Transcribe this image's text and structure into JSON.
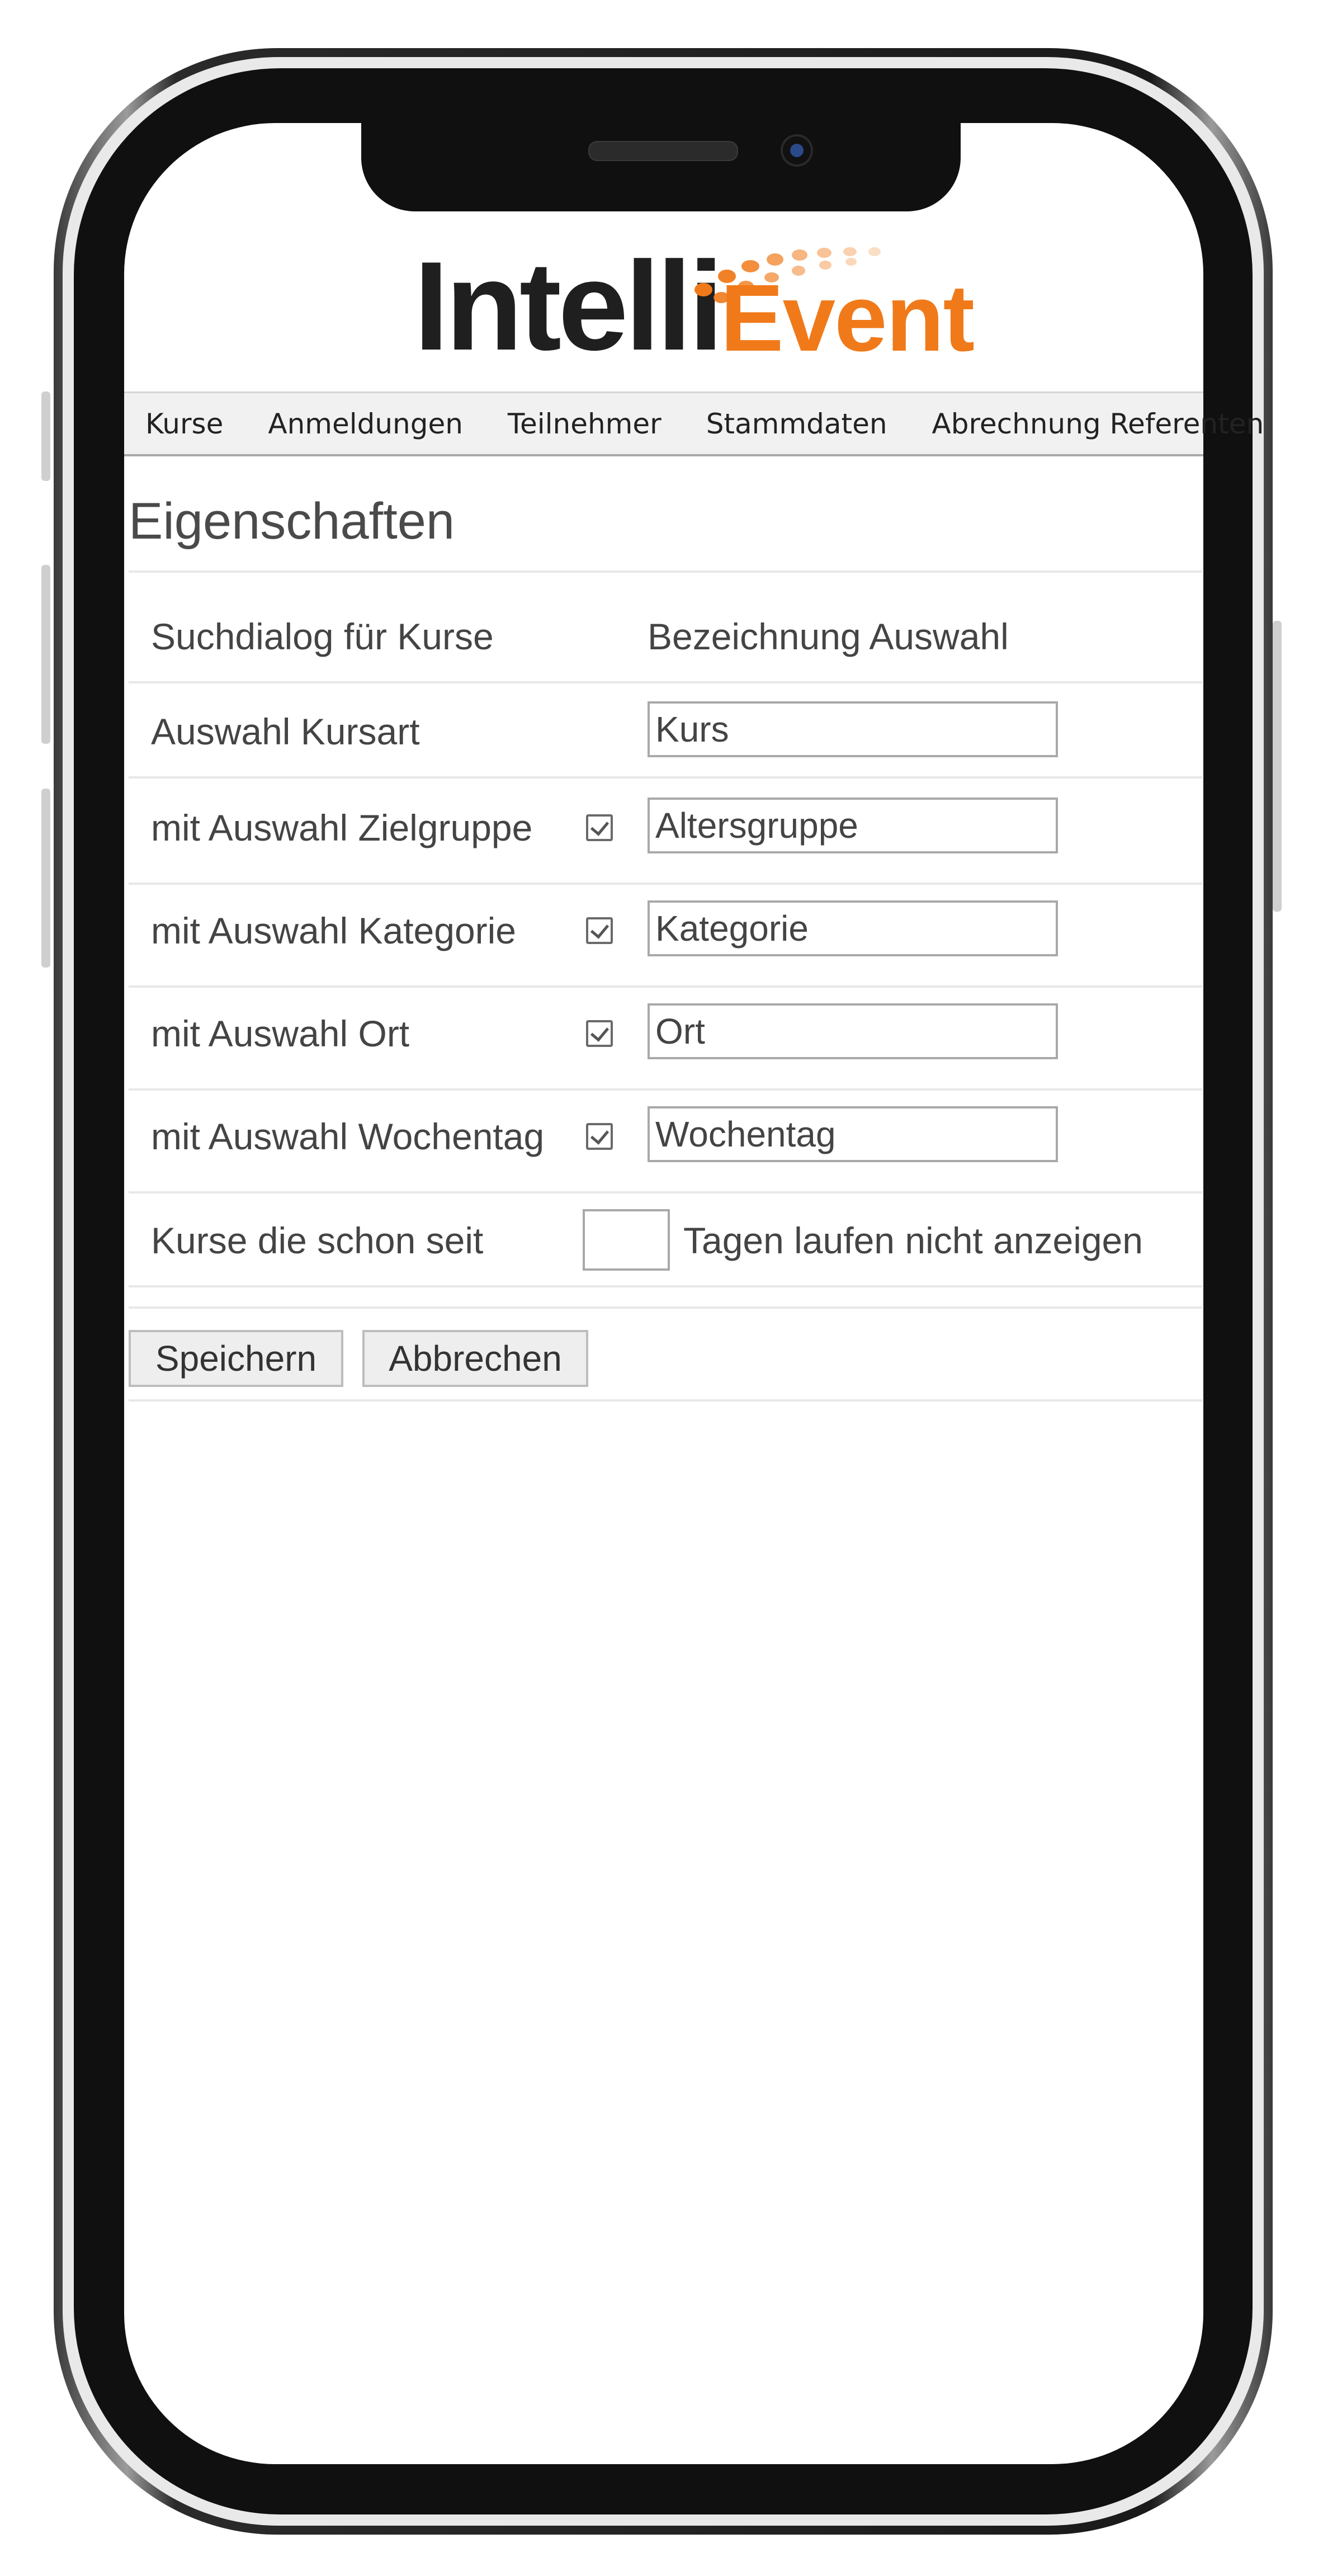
{
  "logo": {
    "part1": "Intelli",
    "part2": "Event",
    "accent": "#f07a1a",
    "dark": "#1f1f1f"
  },
  "nav": {
    "items": [
      "Kurse",
      "Anmeldungen",
      "Teilnehmer",
      "Stammdaten",
      "Abrechnung Referenten"
    ]
  },
  "page": {
    "title": "Eigenschaften"
  },
  "form": {
    "header": {
      "label": "Suchdialog für Kurse",
      "column": "Bezeichnung Auswahl"
    },
    "rows": [
      {
        "label": "Auswahl Kursart",
        "value": "Kurs",
        "checked": null
      },
      {
        "label": "mit Auswahl Zielgruppe",
        "value": "Altersgruppe",
        "checked": true
      },
      {
        "label": "mit Auswahl Kategorie",
        "value": "Kategorie",
        "checked": true
      },
      {
        "label": "mit Auswahl Ort",
        "value": "Ort",
        "checked": true
      },
      {
        "label": "mit Auswahl Wochentag",
        "value": "Wochentag",
        "checked": true
      }
    ],
    "days": {
      "label_before": "Kurse die schon seit",
      "value": "",
      "label_after": "Tagen laufen nicht anzeigen"
    }
  },
  "buttons": {
    "save": "Speichern",
    "cancel": "Abbrechen"
  }
}
